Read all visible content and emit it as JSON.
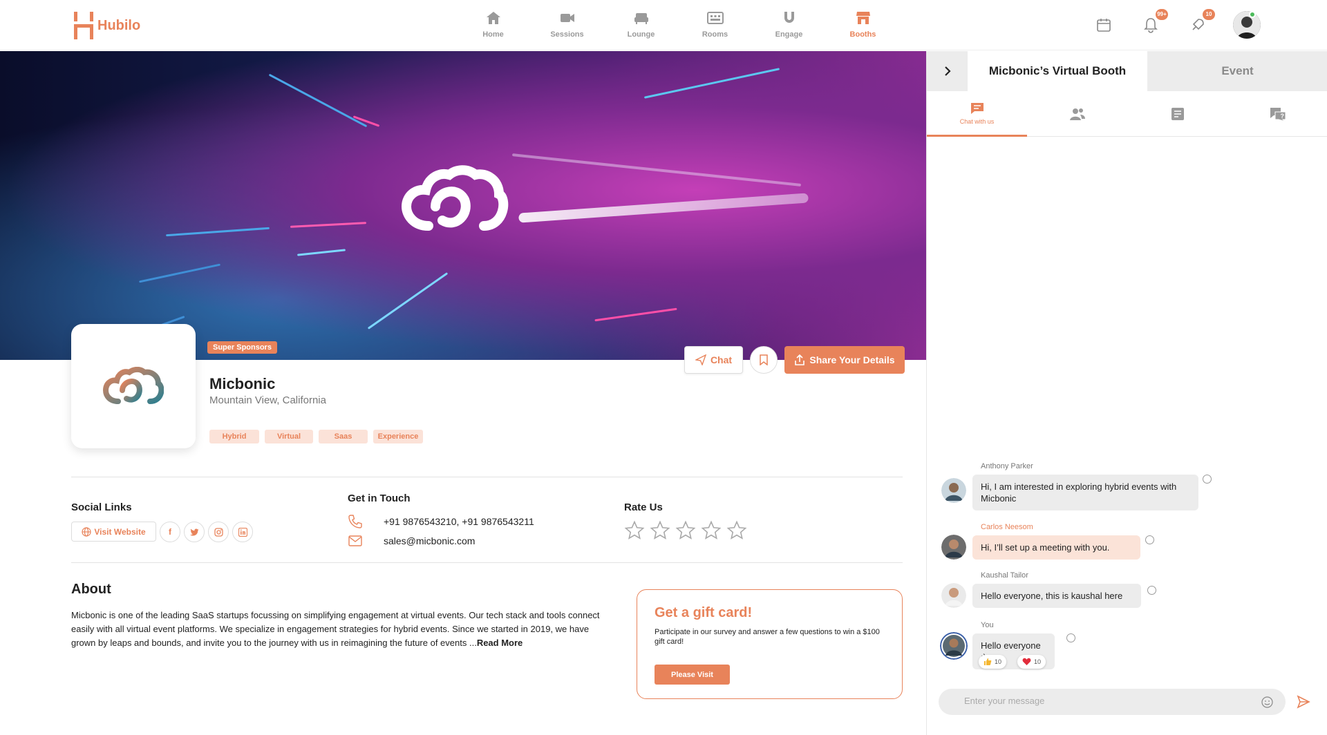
{
  "app": {
    "name": "Hubilo"
  },
  "nav": [
    {
      "label": "Home",
      "icon": "home-icon"
    },
    {
      "label": "Sessions",
      "icon": "video-icon"
    },
    {
      "label": "Lounge",
      "icon": "sofa-icon"
    },
    {
      "label": "Rooms",
      "icon": "grid-icon"
    },
    {
      "label": "Engage",
      "icon": "magnet-icon"
    },
    {
      "label": "Booths",
      "icon": "booth-icon",
      "active": true
    }
  ],
  "top_icons": {
    "notifications_badge": "99+",
    "tasks_badge": "10"
  },
  "booth": {
    "sponsor_badge": "Super Sponsors",
    "name": "Micbonic",
    "location": "Mountain View, California",
    "tags": [
      "Hybrid",
      "Virtual",
      "Saas",
      "Experience"
    ],
    "chat_label": "Chat",
    "share_label": "Share Your Details"
  },
  "social": {
    "title": "Social Links",
    "visit_label": "Visit Website",
    "icons": [
      "f",
      "t",
      "i",
      "in"
    ]
  },
  "contact": {
    "title": "Get in Touch",
    "phone": "+91 9876543210, +91 9876543211",
    "email": "sales@micbonic.com"
  },
  "rating": {
    "title": "Rate Us",
    "value": 0,
    "max": 5
  },
  "about": {
    "title": "About",
    "text": "Micbonic is one of the leading SaaS startups focussing on simplifying engagement at virtual events. Our tech stack and tools connect easily with all virtual event platforms. We specialize in engagement strategies for hybrid events. Since we started in 2019, we have grown by leaps and bounds, and invite you to the journey with us in reimagining the future of events ...",
    "read_more": "Read More"
  },
  "gift": {
    "title": "Get a gift card!",
    "description": "Participate in our survey and answer a few questions to win a $100 gift card!",
    "button": "Please Visit"
  },
  "panel": {
    "tab_booth": "Micbonic’s Virtual Booth",
    "tab_event": "Event",
    "subtab_chat": "Chat with us"
  },
  "messages": [
    {
      "name": "Anthony Parker",
      "text": "Hi, I am interested in exploring hybrid events with Micbonic"
    },
    {
      "name": "Carlos Neesom",
      "text": "Hi, I’ll set up a meeting with you."
    },
    {
      "name": "Kaushal Tailor",
      "text": "Hello everyone, this is kaushal here"
    },
    {
      "name": "You",
      "text": "Hello everyone :)"
    }
  ],
  "reactions": [
    {
      "emoji": "thumbs-up",
      "count": "10"
    },
    {
      "emoji": "heart",
      "count": "10"
    }
  ],
  "chat_input": {
    "placeholder": "Enter your message"
  },
  "colors": {
    "accent": "#e8835a",
    "accent_light": "#fbe2d8",
    "online": "#4cbb5b"
  }
}
